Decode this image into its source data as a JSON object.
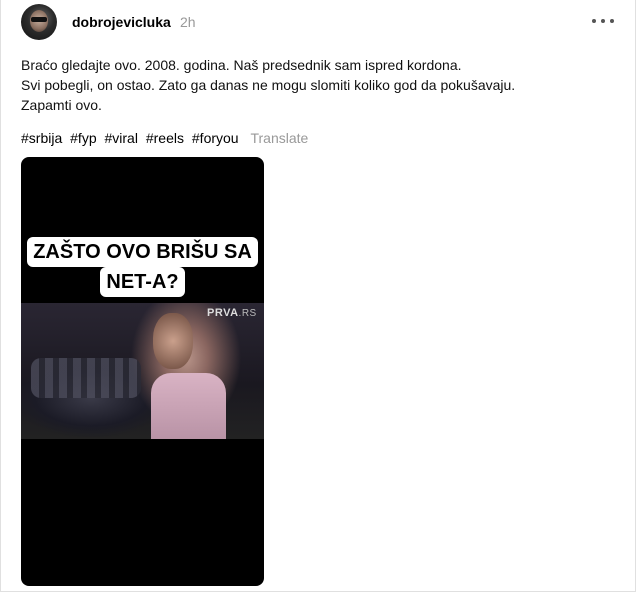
{
  "post": {
    "username": "dobrojevicluka",
    "time": "2h",
    "caption_lines": [
      "Braćo gledajte ovo. 2008. godina. Naš predsednik sam ispred kordona.",
      "Svi pobegli, on ostao. Zato ga danas ne mogu slomiti koliko god da pokušavaju.",
      "Zapamti ovo."
    ],
    "hashtags": [
      "#srbija",
      "#fyp",
      "#viral",
      "#reels",
      "#foryou"
    ],
    "translate_label": "Translate"
  },
  "video": {
    "headline_line1": "ZAŠTO OVO BRIŠU SA",
    "headline_line2": "NET-A?",
    "watermark_main": "PRVA",
    "watermark_suffix": ".RS"
  },
  "icons": {
    "more": "more-options-icon"
  }
}
